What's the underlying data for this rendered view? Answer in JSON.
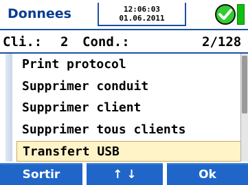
{
  "header": {
    "title": "Donnees",
    "time": "12:06:03",
    "date": "01.06.2011",
    "status_icon": "check-circle-icon",
    "battery_icon": "battery-icon",
    "status_color": "#33cc33"
  },
  "info": {
    "client_label": "Cli.:",
    "client_value": "2",
    "conduit_label": "Cond.:",
    "conduit_value": "2/128"
  },
  "menu": {
    "items": [
      {
        "label": "Print protocol"
      },
      {
        "label": "Supprimer conduit"
      },
      {
        "label": "Supprimer client"
      },
      {
        "label": "Supprimer tous clients"
      },
      {
        "label": "Transfert USB"
      }
    ],
    "selected_index": 4
  },
  "footer": {
    "sortir_label": "Sortir",
    "nav_label": "↑ ↓",
    "ok_label": "Ok"
  },
  "colors": {
    "title": "#0a3d8f",
    "footer_button": "#1f66c8",
    "selection": "#fff3c8",
    "border": "#1a4fa0"
  }
}
